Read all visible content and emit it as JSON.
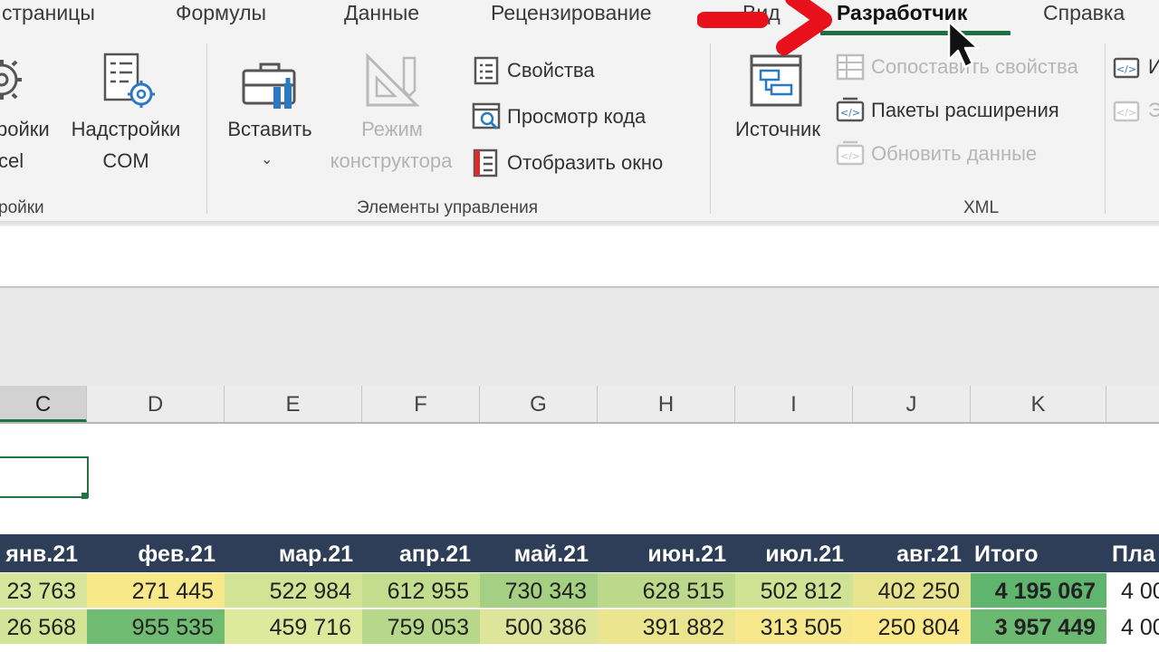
{
  "tabs": [
    {
      "label": "страницы",
      "active": false
    },
    {
      "label": "Формулы",
      "active": false
    },
    {
      "label": "Данные",
      "active": false
    },
    {
      "label": "Рецензирование",
      "active": false
    },
    {
      "label": "Вид",
      "active": false
    },
    {
      "label": "Разработчик",
      "active": true
    },
    {
      "label": "Справка",
      "active": false
    }
  ],
  "ribbon": {
    "addins_group": {
      "excel_addins_label_1": "ройки",
      "excel_addins_label_2": "cel",
      "com_addins_label_1": "Надстройки",
      "com_addins_label_2": "COM",
      "group_label": "ройки"
    },
    "controls_group": {
      "insert_label": "Вставить",
      "design_mode_label_1": "Режим",
      "design_mode_label_2": "конструктора",
      "properties_label": "Свойства",
      "view_code_label": "Просмотр кода",
      "run_dialog_label": "Отобразить окно",
      "group_label": "Элементы управления"
    },
    "xml_group": {
      "source_label": "Источник",
      "map_properties_label": "Сопоставить свойства",
      "expansion_packs_label": "Пакеты расширения",
      "refresh_data_label": "Обновить данные",
      "group_label": "XML",
      "import_label": "И",
      "export_label": "Э"
    }
  },
  "columns": [
    "C",
    "D",
    "E",
    "F",
    "G",
    "H",
    "I",
    "J",
    "K"
  ],
  "selected_column": "C",
  "table": {
    "headers": [
      "янв.21",
      "фев.21",
      "мар.21",
      "апр.21",
      "май.21",
      "июн.21",
      "июл.21",
      "авг.21",
      "Итого",
      "Пла"
    ],
    "rows": [
      {
        "values": [
          "23 763",
          "271 445",
          "522 984",
          "612 955",
          "730 343",
          "628 515",
          "502 812",
          "402 250",
          "4 195 067",
          "4 00"
        ]
      },
      {
        "values": [
          "26 568",
          "955 535",
          "459 716",
          "759 053",
          "500 386",
          "391 882",
          "313 505",
          "250 804",
          "3 957 449",
          "4 00"
        ]
      }
    ],
    "row_colors": [
      [
        "#d7e69a",
        "#f7e98a",
        "#d3e395",
        "#c3dd8f",
        "#a5d084",
        "#bcd98b",
        "#d0e294",
        "#e7e48d",
        "#5fb46e",
        "#ffffff"
      ],
      [
        "#d4e497",
        "#70bb72",
        "#ddea9c",
        "#b7d88b",
        "#dde59a",
        "#ece58f",
        "#f4e78c",
        "#fbe88a",
        "#6bb970",
        "#ffffff"
      ]
    ]
  },
  "colors": {
    "accent": "#217346",
    "header_bg": "#2f3e58",
    "arrow": "#e8101a"
  }
}
